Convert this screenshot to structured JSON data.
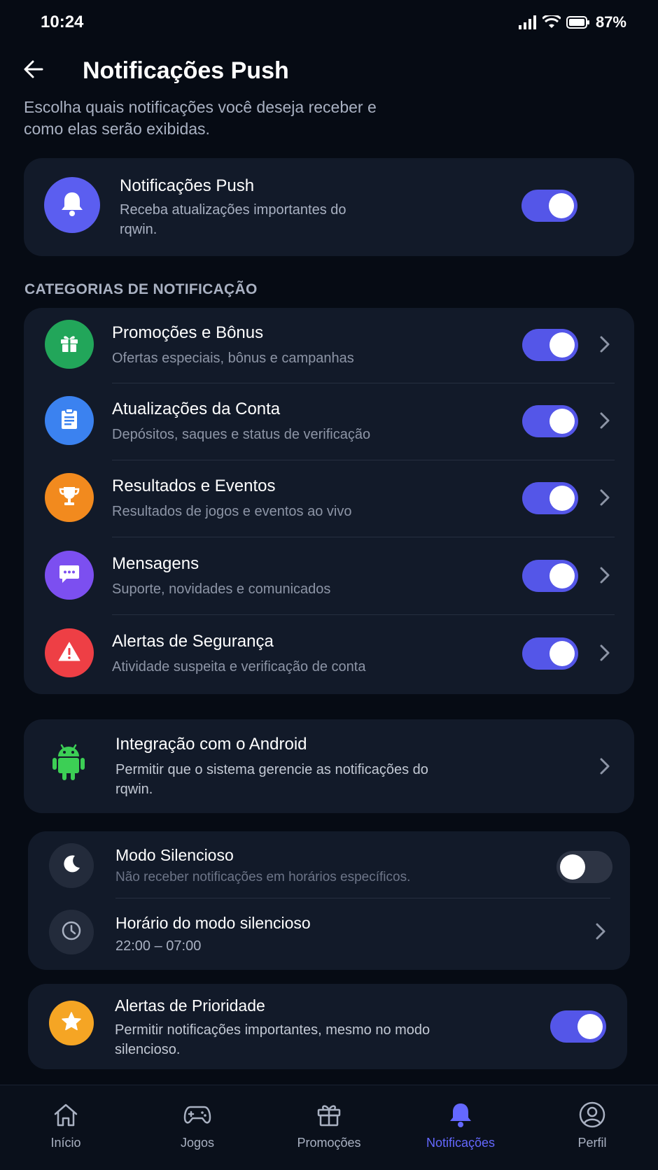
{
  "status_bar": {
    "time": "10:24",
    "battery": "87%"
  },
  "header": {
    "title": "Notificações Push",
    "subtitle": "Escolha quais notificações você deseja receber e como elas serão exibidas."
  },
  "master": {
    "title": "Notificações Push",
    "description": "Receba atualizações importantes do rqwin.",
    "enabled": true,
    "icon": "bell-icon",
    "color": "#5b5ef0"
  },
  "section_label": "CATEGORIAS DE NOTIFICAÇÃO",
  "categories": [
    {
      "title": "Promoções e Bônus",
      "description": "Ofertas especiais, bônus e campanhas",
      "icon": "gift-icon",
      "color": "#22a65a",
      "enabled": true
    },
    {
      "title": "Atualizações da Conta",
      "description": "Depósitos, saques e status de verificação",
      "icon": "clipboard-icon",
      "color": "#3b82f0",
      "enabled": true
    },
    {
      "title": "Resultados e Eventos",
      "description": "Resultados de jogos e eventos ao vivo",
      "icon": "trophy-icon",
      "color": "#f28a1e",
      "enabled": true
    },
    {
      "title": "Mensagens",
      "description": "Suporte, novidades e comunicados",
      "icon": "chat-icon",
      "color": "#7c4ff0",
      "enabled": true
    },
    {
      "title": "Alertas de Segurança",
      "description": "Atividade suspeita e verificação de conta",
      "icon": "warning-icon",
      "color": "#ee3f45",
      "enabled": true
    }
  ],
  "android": {
    "title": "Integração com o Android",
    "description": "Permitir que o sistema gerencie as notificações do rqwin.",
    "icon": "android-icon",
    "color": "#3ccf55"
  },
  "quiet_mode": {
    "title": "Modo Silencioso",
    "description": "Não receber notificações em horários específicos.",
    "enabled": false,
    "schedule_title": "Horário do modo silencioso",
    "schedule_value": "22:00 – 07:00"
  },
  "priority": {
    "title": "Alertas de Prioridade",
    "description": "Permitir notificações importantes, mesmo no modo silencioso.",
    "enabled": true,
    "icon": "star-icon",
    "color": "#f5a524"
  },
  "bottom_nav": [
    {
      "label": "Início",
      "icon": "home-icon",
      "active": false
    },
    {
      "label": "Jogos",
      "icon": "gamepad-icon",
      "active": false
    },
    {
      "label": "Promoções",
      "icon": "gift-icon",
      "active": false
    },
    {
      "label": "Notificações",
      "icon": "bell-icon",
      "active": true
    },
    {
      "label": "Perfil",
      "icon": "user-icon",
      "active": false
    }
  ],
  "accent_color": "#5456e8"
}
